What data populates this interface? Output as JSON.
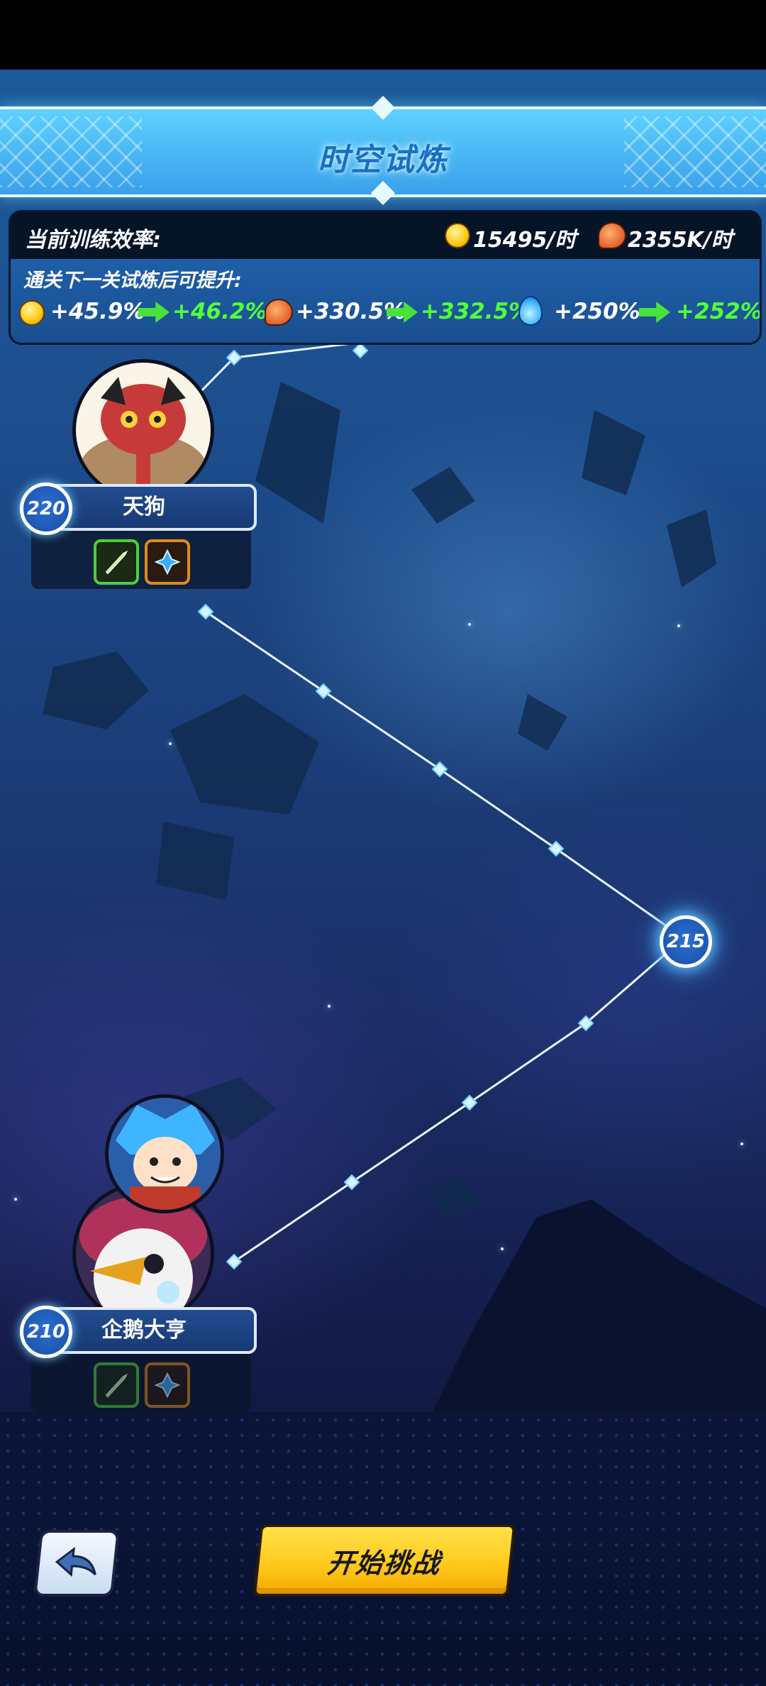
{
  "header": {
    "title": "时空试炼"
  },
  "efficiency": {
    "label": "当前训练效率:",
    "gold_rate": "15495/时",
    "food_rate": "2355K/时",
    "boost_label": "通关下一关试炼后可提升:",
    "gold_from": "+45.9%",
    "gold_to": "+46.2%",
    "food_from": "+330.5%",
    "food_to": "+332.5%",
    "exp_from": "+250%",
    "exp_to": "+252%",
    "icons": [
      "coin-icon",
      "meat-icon",
      "water-drop-icon",
      "green-arrow-icon"
    ]
  },
  "path": {
    "levels": [
      {
        "level": "220",
        "name": "天狗"
      },
      {
        "level": "215"
      },
      {
        "level": "210",
        "name": "企鹅大亨"
      }
    ]
  },
  "buttons": {
    "start_label": "开始挑战"
  },
  "colors": {
    "banner_blue": "#4ab8f5",
    "start_yellow": "#ffc81a",
    "boost_green": "#52ff3c",
    "panel_blue": "#1f5fa8"
  }
}
